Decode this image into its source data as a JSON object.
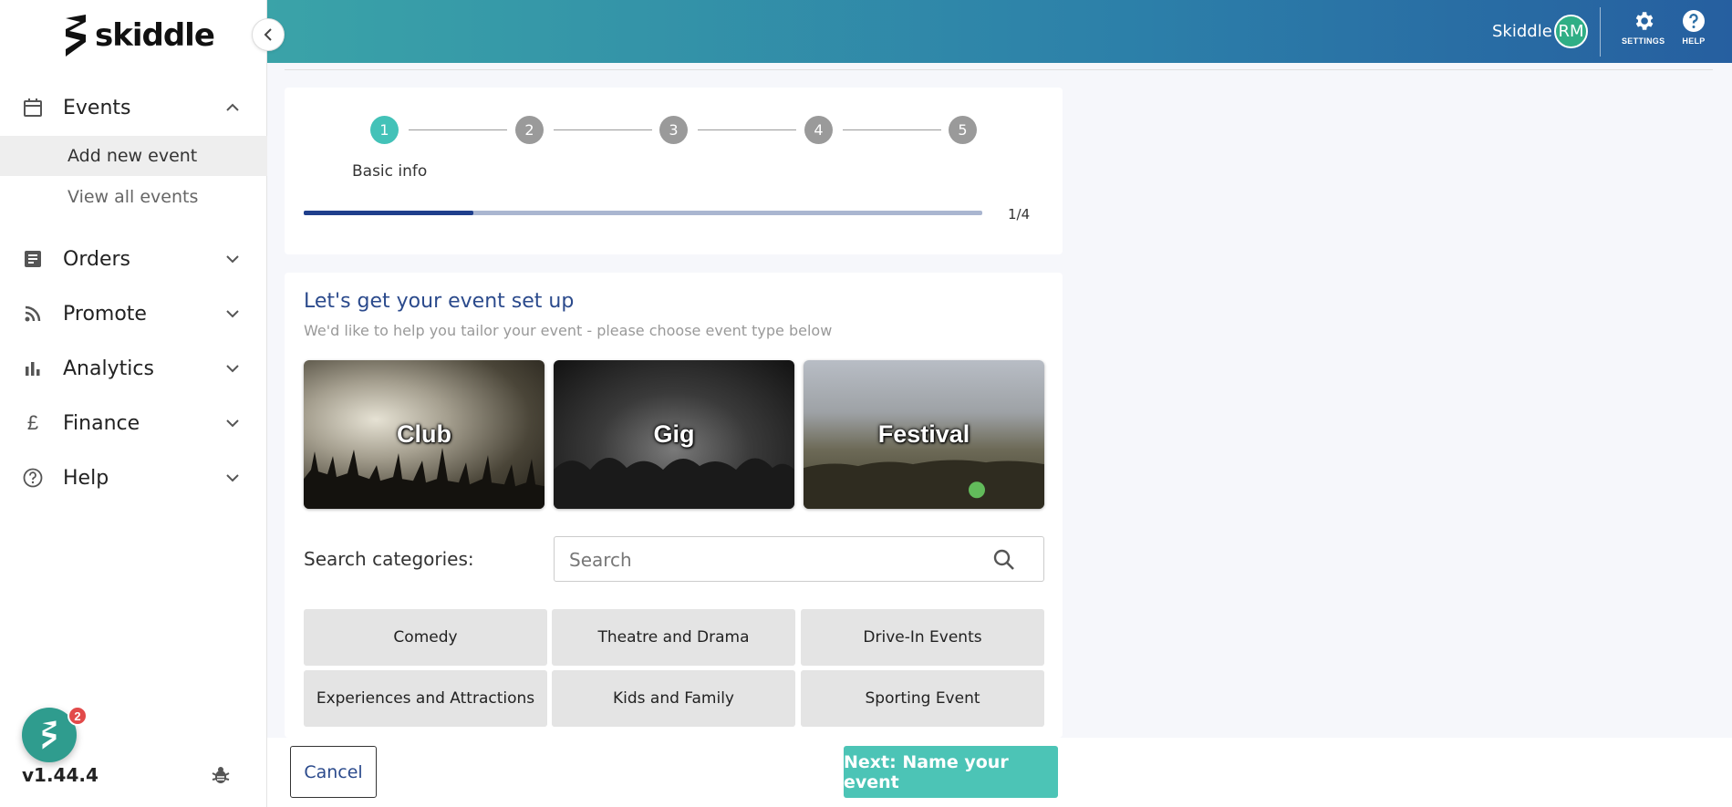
{
  "brand": {
    "logo_text": "skiddle"
  },
  "sidebar": {
    "sections": [
      {
        "label": "Events",
        "icon": "calendar-icon",
        "expanded": true
      },
      {
        "label": "Orders",
        "icon": "receipt-icon",
        "expanded": false
      },
      {
        "label": "Promote",
        "icon": "rss-icon",
        "expanded": false
      },
      {
        "label": "Analytics",
        "icon": "bar-chart-icon",
        "expanded": false
      },
      {
        "label": "Finance",
        "icon": "pound-icon",
        "expanded": false
      },
      {
        "label": "Help",
        "icon": "question-icon",
        "expanded": false
      }
    ],
    "events_sub": [
      {
        "label": "Add new event",
        "active": true
      },
      {
        "label": "View all events",
        "active": false
      }
    ],
    "chat_badge": "2",
    "version": "v1.44.4"
  },
  "header": {
    "user_name": "Skiddle",
    "avatar_initials": "RM",
    "settings_label": "SETTINGS",
    "help_label": "HELP"
  },
  "stepper": {
    "steps": [
      "1",
      "2",
      "3",
      "4",
      "5"
    ],
    "current_step": 1,
    "current_label": "Basic info",
    "progress_text": "1/4",
    "progress_fraction": 0.25
  },
  "setup": {
    "title": "Let's get your event set up",
    "subtitle": "We'd like to help you tailor your event - please choose event type below",
    "event_types": [
      "Club",
      "Gig",
      "Festival"
    ],
    "search_label": "Search categories:",
    "search_placeholder": "Search",
    "categories": [
      "Comedy",
      "Theatre and Drama",
      "Drive-In Events",
      "Experiences and Attractions",
      "Kids and Family",
      "Sporting Event"
    ]
  },
  "footer": {
    "cancel_label": "Cancel",
    "next_label": "Next: Name your event"
  },
  "colors": {
    "accent": "#4cc4b6",
    "step_active": "#43c2b8",
    "heading": "#2b4a8c",
    "progress": "#1f3f8c"
  }
}
